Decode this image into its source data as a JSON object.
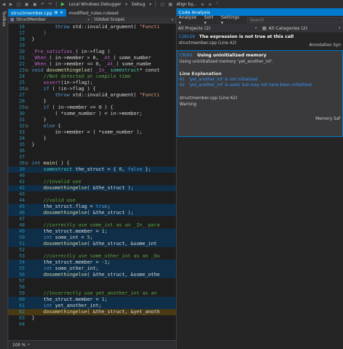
{
  "toolbar": {
    "debugger_label": "Local Windows Debugger",
    "config_label": "Debug",
    "align_label": "Align by..."
  },
  "toolbox": {
    "label": "Toolbox"
  },
  "tabs": [
    {
      "label": "structmember.cpp",
      "active": true
    },
    {
      "label": "modified_rules.ruleset",
      "active": false
    }
  ],
  "navbar": {
    "left": "StructMember",
    "right": "(Global Scope)"
  },
  "code_lines": [
    {
      "n": "16",
      "fold": "",
      "hl": false,
      "segs": [
        [
          "",
          "        "
        ],
        [
          "kw",
          "throw"
        ],
        [
          "",
          " std::invalid_argument( "
        ],
        [
          "st",
          "\"Functi"
        ]
      ]
    },
    {
      "n": "17",
      "fold": "",
      "hl": false,
      "segs": [
        [
          "",
          "    "
        ],
        [
          "pil",
          "}"
        ]
      ]
    },
    {
      "n": "18",
      "fold": "",
      "hl": false,
      "segs": [
        [
          "",
          "}"
        ]
      ]
    },
    {
      "n": "19",
      "fold": "",
      "hl": false,
      "segs": []
    },
    {
      "n": "20",
      "fold": "",
      "hl": false,
      "segs": [
        [
          "mc",
          "_Pre_satisfies_"
        ],
        [
          "",
          "( in->flag )"
        ]
      ]
    },
    {
      "n": "21",
      "fold": "",
      "hl": false,
      "segs": [
        [
          "mc",
          "_When_"
        ],
        [
          "",
          "( in->member > 0, "
        ],
        [
          "mc",
          "_At_"
        ],
        [
          "",
          "( some_number"
        ]
      ]
    },
    {
      "n": "22",
      "fold": "",
      "hl": false,
      "segs": [
        [
          "mc",
          "_When_"
        ],
        [
          "",
          "( in->member <= 0, "
        ],
        [
          "mc",
          "_At_"
        ],
        [
          "",
          "( some_numbe"
        ]
      ]
    },
    {
      "n": "23",
      "fold": "⊟",
      "hl": false,
      "segs": [
        [
          "kw",
          "void"
        ],
        [
          "",
          " "
        ],
        [
          "fn",
          "dosomethingelse"
        ],
        [
          "",
          "( "
        ],
        [
          "mc",
          "_In_"
        ],
        [
          "",
          " "
        ],
        [
          "ty",
          "somestruct"
        ],
        [
          "",
          "* const"
        ]
      ]
    },
    {
      "n": "24",
      "fold": "",
      "hl": false,
      "segs": [
        [
          "",
          "    "
        ],
        [
          "cm",
          "//Not detected at compile time"
        ]
      ]
    },
    {
      "n": "25",
      "fold": "",
      "hl": false,
      "segs": [
        [
          "",
          "    "
        ],
        [
          "mc",
          "assert"
        ],
        [
          "",
          "(in->flag);"
        ]
      ]
    },
    {
      "n": "26",
      "fold": "⊟",
      "hl": false,
      "segs": [
        [
          "",
          "    "
        ],
        [
          "kw",
          "if"
        ],
        [
          "",
          " ( !in->flag ) {"
        ]
      ]
    },
    {
      "n": "27",
      "fold": "",
      "hl": false,
      "segs": [
        [
          "",
          "        "
        ],
        [
          "kw",
          "throw"
        ],
        [
          "",
          " std::invalid_argument( "
        ],
        [
          "st",
          "\"Functi"
        ]
      ]
    },
    {
      "n": "28",
      "fold": "",
      "hl": false,
      "segs": [
        [
          "",
          "    }"
        ]
      ]
    },
    {
      "n": "29",
      "fold": "⊟",
      "hl": false,
      "segs": [
        [
          "",
          "    "
        ],
        [
          "kw",
          "if"
        ],
        [
          "",
          " ( in->member <= 0 ) {"
        ]
      ]
    },
    {
      "n": "30",
      "fold": "",
      "hl": false,
      "segs": [
        [
          "",
          "        ( *some_number ) = in->member;"
        ]
      ]
    },
    {
      "n": "31",
      "fold": "",
      "hl": false,
      "segs": [
        [
          "",
          "    }"
        ]
      ]
    },
    {
      "n": "32",
      "fold": "⊟",
      "hl": false,
      "segs": [
        [
          "",
          "    "
        ],
        [
          "kw",
          "else"
        ],
        [
          "",
          " {"
        ]
      ]
    },
    {
      "n": "33",
      "fold": "",
      "hl": false,
      "segs": [
        [
          "",
          "        in->member = ( *some_number );"
        ]
      ]
    },
    {
      "n": "34",
      "fold": "",
      "hl": false,
      "segs": [
        [
          "",
          "    }"
        ]
      ]
    },
    {
      "n": "35",
      "fold": "",
      "hl": false,
      "segs": [
        [
          "",
          "}"
        ]
      ]
    },
    {
      "n": "36",
      "fold": "",
      "hl": false,
      "segs": []
    },
    {
      "n": "37",
      "fold": "",
      "hl": false,
      "segs": []
    },
    {
      "n": "38",
      "fold": "⊟",
      "hl": false,
      "segs": [
        [
          "kw",
          "int"
        ],
        [
          "",
          " "
        ],
        [
          "fn",
          "main"
        ],
        [
          "",
          "( ) {"
        ]
      ]
    },
    {
      "n": "39",
      "fold": "",
      "hl": true,
      "segs": [
        [
          "",
          "    "
        ],
        [
          "ty",
          "somestruct"
        ],
        [
          "",
          " the_struct = { "
        ],
        [
          "nm",
          "0"
        ],
        [
          "",
          ", "
        ],
        [
          "kw",
          "false"
        ],
        [
          "",
          " };"
        ]
      ]
    },
    {
      "n": "40",
      "fold": "",
      "hl": false,
      "segs": []
    },
    {
      "n": "41",
      "fold": "",
      "hl": false,
      "segs": [
        [
          "",
          "    "
        ],
        [
          "cm",
          "//invalid use"
        ]
      ]
    },
    {
      "n": "42",
      "fold": "",
      "hl": true,
      "segs": [
        [
          "",
          "    "
        ],
        [
          "fn",
          "dosomethingelse"
        ],
        [
          "",
          "( &the_struct );"
        ]
      ]
    },
    {
      "n": "43",
      "fold": "",
      "hl": false,
      "segs": []
    },
    {
      "n": "44",
      "fold": "",
      "hl": false,
      "segs": [
        [
          "",
          "    "
        ],
        [
          "cm",
          "//valid use"
        ]
      ]
    },
    {
      "n": "45",
      "fold": "",
      "hl": true,
      "segs": [
        [
          "",
          "    the_struct.flag = "
        ],
        [
          "kw",
          "true"
        ],
        [
          "",
          ";"
        ]
      ]
    },
    {
      "n": "46",
      "fold": "",
      "hl": true,
      "segs": [
        [
          "",
          "    "
        ],
        [
          "fn",
          "dosomethingelse"
        ],
        [
          "",
          "( &the_struct );"
        ]
      ]
    },
    {
      "n": "47",
      "fold": "",
      "hl": false,
      "segs": []
    },
    {
      "n": "48",
      "fold": "",
      "hl": false,
      "segs": [
        [
          "",
          "    "
        ],
        [
          "cm",
          "//correctly use some_int as an _In_ para"
        ]
      ]
    },
    {
      "n": "49",
      "fold": "",
      "hl": true,
      "segs": [
        [
          "",
          "    the_struct.member = "
        ],
        [
          "nm",
          "1"
        ],
        [
          "",
          ";"
        ]
      ]
    },
    {
      "n": "50",
      "fold": "",
      "hl": true,
      "segs": [
        [
          "",
          "    "
        ],
        [
          "kw",
          "int"
        ],
        [
          "",
          " some_int = "
        ],
        [
          "nm",
          "5"
        ],
        [
          "",
          ";"
        ]
      ]
    },
    {
      "n": "51",
      "fold": "",
      "hl": true,
      "segs": [
        [
          "",
          "    "
        ],
        [
          "fn",
          "dosomethingelse"
        ],
        [
          "",
          "( &the_struct, &some_int"
        ]
      ]
    },
    {
      "n": "52",
      "fold": "",
      "hl": false,
      "segs": []
    },
    {
      "n": "53",
      "fold": "",
      "hl": false,
      "segs": [
        [
          "",
          "    "
        ],
        [
          "cm",
          "//correctly use some_other_int as an _Ou"
        ]
      ]
    },
    {
      "n": "54",
      "fold": "",
      "hl": true,
      "segs": [
        [
          "",
          "    the_struct.member = "
        ],
        [
          "nm",
          "-1"
        ],
        [
          "",
          ";"
        ]
      ]
    },
    {
      "n": "55",
      "fold": "",
      "hl": true,
      "segs": [
        [
          "",
          "    "
        ],
        [
          "kw",
          "int"
        ],
        [
          "",
          " some_other_int;"
        ]
      ]
    },
    {
      "n": "56",
      "fold": "",
      "hl": true,
      "segs": [
        [
          "",
          "    "
        ],
        [
          "fn",
          "dosomethingelse"
        ],
        [
          "",
          "( &the_struct, &some_othe"
        ]
      ]
    },
    {
      "n": "57",
      "fold": "",
      "hl": false,
      "segs": []
    },
    {
      "n": "58",
      "fold": "",
      "hl": false,
      "segs": []
    },
    {
      "n": "59",
      "fold": "",
      "hl": false,
      "segs": [
        [
          "",
          "    "
        ],
        [
          "cm",
          "//incorrectly use yet_another_int as an"
        ]
      ]
    },
    {
      "n": "60",
      "fold": "",
      "hl": true,
      "segs": [
        [
          "",
          "    the_struct.member = "
        ],
        [
          "nm",
          "1"
        ],
        [
          "",
          ";"
        ]
      ]
    },
    {
      "n": "61",
      "fold": "",
      "hl": true,
      "segs": [
        [
          "",
          "    "
        ],
        [
          "kw",
          "int"
        ],
        [
          "",
          " yet_another_int;"
        ]
      ]
    },
    {
      "n": "62",
      "fold": "",
      "hl": "cur",
      "segs": [
        [
          "",
          "    "
        ],
        [
          "fn",
          "dosomethingelse"
        ],
        [
          "",
          "( &the_struct, &yet_anoth"
        ]
      ]
    },
    {
      "n": "63",
      "fold": "",
      "hl": false,
      "segs": [
        [
          "",
          "}"
        ]
      ]
    },
    {
      "n": "64",
      "fold": "",
      "hl": false,
      "segs": []
    }
  ],
  "editor_status": {
    "zoom": "100 %"
  },
  "code_analysis": {
    "title": "Code Analysis",
    "analyze_label": "Analyze",
    "sort_label": "Sort",
    "settings_label": "Settings",
    "search_placeholder": "Search",
    "filter_projects": "All Projects (2)",
    "filter_categories": "All Categories (2)",
    "items": [
      {
        "code": "C28159",
        "title": "The expression is not true at this call",
        "location": "structmember.cpp (Line 42)",
        "category": "Annotation Syn"
      },
      {
        "code": "C6001",
        "title": "Using uninitialized memory",
        "description": "Using uninitialized memory 'yet_another_int'.",
        "section": "Line Explanation",
        "explanations": [
          {
            "line": "61",
            "text": "'yet_another_int' is not initialized"
          },
          {
            "line": "62",
            "text": "'yet_another_int' is used, but may not have been initialized"
          }
        ],
        "location": "structmember.cpp (Line 62)",
        "category": "Memory Saf",
        "severity": "Warning"
      }
    ]
  },
  "colors": {
    "accent": "#007acc",
    "editor_bg": "#1e1e1e",
    "panel_bg": "#252526",
    "chrome_bg": "#2d2d30"
  }
}
